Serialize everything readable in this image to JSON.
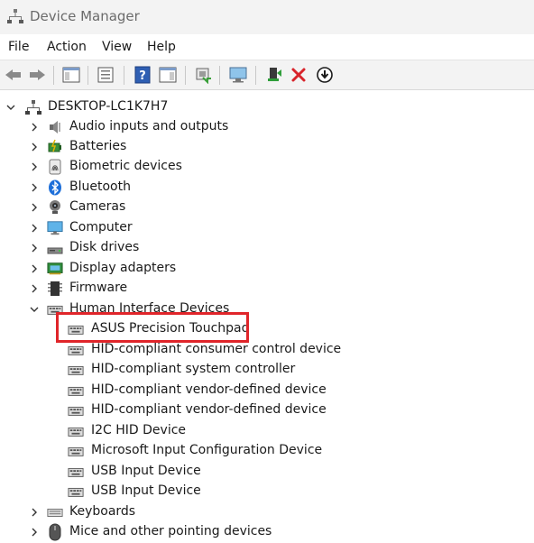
{
  "window": {
    "title": "Device Manager"
  },
  "menu": [
    "File",
    "Action",
    "View",
    "Help"
  ],
  "toolbar": {
    "buttons": [
      "back-icon",
      "forward-icon",
      "show-hide-console-tree-icon",
      "properties-icon",
      "help-icon",
      "action-pane-icon",
      "update-driver-icon",
      "scan-hardware-icon",
      "enable-device-icon",
      "uninstall-icon",
      "download-icon"
    ]
  },
  "colors": {
    "highlight": "#e0252a",
    "uninstall": "#d8242b",
    "bluetooth": "#1e6fd9"
  },
  "tree": {
    "root": "DESKTOP-LC1K7H7",
    "categories": [
      {
        "label": "Audio inputs and outputs",
        "icon": "speaker-icon",
        "expanded": false
      },
      {
        "label": "Batteries",
        "icon": "battery-icon",
        "expanded": false
      },
      {
        "label": "Biometric devices",
        "icon": "fingerprint-icon",
        "expanded": false
      },
      {
        "label": "Bluetooth",
        "icon": "bluetooth-icon",
        "expanded": false
      },
      {
        "label": "Cameras",
        "icon": "camera-icon",
        "expanded": false
      },
      {
        "label": "Computer",
        "icon": "monitor-icon",
        "expanded": false
      },
      {
        "label": "Disk drives",
        "icon": "disk-icon",
        "expanded": false
      },
      {
        "label": "Display adapters",
        "icon": "display-adapter-icon",
        "expanded": false
      },
      {
        "label": "Firmware",
        "icon": "chip-icon",
        "expanded": false
      },
      {
        "label": "Human Interface Devices",
        "icon": "hid-icon",
        "expanded": true
      }
    ],
    "hid_children": [
      "ASUS Precision Touchpad",
      "HID-compliant consumer control device",
      "HID-compliant system controller",
      "HID-compliant vendor-defined device",
      "HID-compliant vendor-defined device",
      "I2C HID Device",
      "Microsoft Input Configuration Device",
      "USB Input Device",
      "USB Input Device"
    ],
    "after": [
      {
        "label": "Keyboards",
        "icon": "keyboard-icon",
        "expanded": false
      },
      {
        "label": "Mice and other pointing devices",
        "icon": "mouse-icon",
        "expanded": false
      }
    ]
  }
}
